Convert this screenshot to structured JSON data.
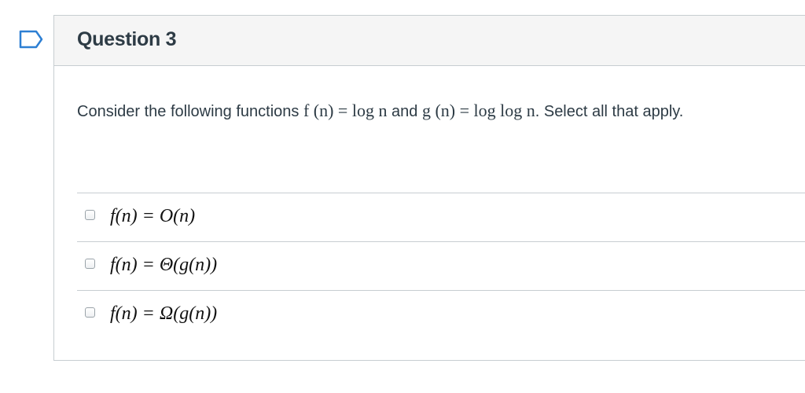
{
  "question": {
    "title": "Question 3",
    "text_before": "Consider the following functions ",
    "f_expr": "f (n) = log n",
    "text_and": " and ",
    "g_expr": "g (n) = log log n",
    "text_after": ". Select all that apply."
  },
  "answers": [
    {
      "label": "f(n) = O(n)",
      "checked": false
    },
    {
      "label": "f(n) = Θ(g(n))",
      "checked": false
    },
    {
      "label": "f(n) = Ω(g(n))",
      "checked": false
    }
  ],
  "colors": {
    "flag_outline": "#2d7fd3",
    "header_bg": "#f5f5f5",
    "border": "#c7cdd1",
    "text": "#2d3b45"
  },
  "icons": {
    "flag": "bookmark-flag-icon",
    "checkbox": "checkbox-icon"
  }
}
